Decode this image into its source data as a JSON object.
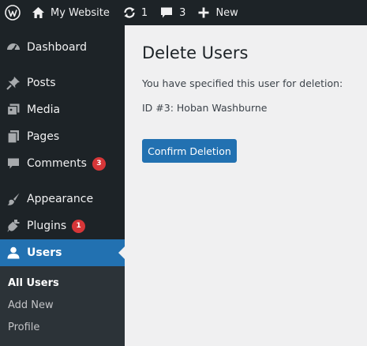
{
  "adminbar": {
    "site_name": "My Website",
    "updates_count": "1",
    "comments_count": "3",
    "new_label": "New"
  },
  "sidebar": {
    "items": [
      {
        "label": "Dashboard",
        "icon": "dashboard-icon"
      },
      {
        "label": "Posts",
        "icon": "pin-icon"
      },
      {
        "label": "Media",
        "icon": "media-icon"
      },
      {
        "label": "Pages",
        "icon": "pages-icon"
      },
      {
        "label": "Comments",
        "icon": "comment-icon",
        "badge": "3"
      },
      {
        "label": "Appearance",
        "icon": "brush-icon"
      },
      {
        "label": "Plugins",
        "icon": "plug-icon",
        "badge": "1"
      },
      {
        "label": "Users",
        "icon": "user-icon",
        "current": true
      }
    ],
    "submenu": [
      {
        "label": "All Users",
        "active": true
      },
      {
        "label": "Add New"
      },
      {
        "label": "Profile"
      }
    ]
  },
  "main": {
    "title": "Delete Users",
    "intro": "You have specified this user for deletion:",
    "user_line": "ID #3: Hoban Washburne",
    "confirm_label": "Confirm Deletion"
  },
  "colors": {
    "admin_dark": "#1d2327",
    "accent": "#2271b1",
    "badge": "#d63638",
    "content_bg": "#f0f0f1"
  }
}
